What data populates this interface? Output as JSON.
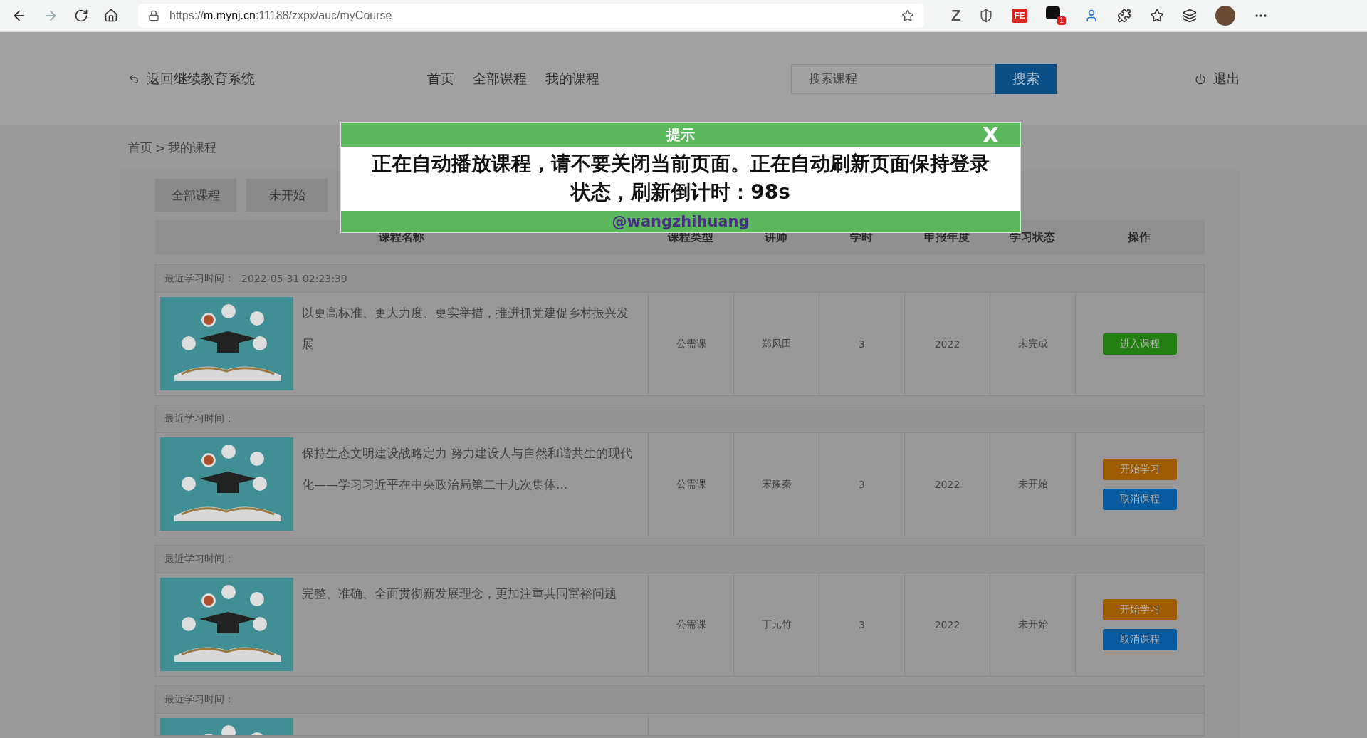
{
  "browser": {
    "url_scheme": "https://",
    "url_host": "m.mynj.cn",
    "url_rest": ":11188/zxpx/auc/myCourse",
    "toolbar_icons": [
      {
        "kind": "letter",
        "text": "Z"
      },
      {
        "kind": "shield"
      },
      {
        "kind": "tag",
        "text": "FE"
      },
      {
        "kind": "badge",
        "text": "1"
      },
      {
        "kind": "person"
      },
      {
        "kind": "puzzle"
      },
      {
        "kind": "favorites"
      },
      {
        "kind": "collections"
      },
      {
        "kind": "avatar"
      },
      {
        "kind": "more"
      }
    ]
  },
  "header": {
    "back_link": "返回继续教育系统",
    "nav": [
      "首页",
      "全部课程",
      "我的课程"
    ],
    "search": {
      "placeholder": "搜索课程",
      "button": "搜索"
    },
    "logout": "退出"
  },
  "breadcrumb": {
    "items": [
      "首页",
      "我的课程"
    ],
    "separator": ">"
  },
  "tabs": [
    "全部课程",
    "未开始"
  ],
  "table": {
    "columns": [
      "课程名称",
      "课程类型",
      "讲师",
      "学时",
      "申报年度",
      "学习状态",
      "操作"
    ],
    "rows": [
      {
        "last_study_label": "最近学习时间：",
        "last_study_time": "2022-05-31 02:23:39",
        "title": "以更高标准、更大力度、更实举措，推进抓党建促乡村振兴发展",
        "type": "公需课",
        "teacher": "郑风田",
        "hours": "3",
        "year": "2022",
        "status": "未完成",
        "actions": [
          {
            "label": "进入课程",
            "kind": "enter"
          }
        ]
      },
      {
        "last_study_label": "最近学习时间：",
        "title": "保持生态文明建设战略定力 努力建设人与自然和谐共生的现代化——学习习近平在中央政治局第二十九次集体...",
        "type": "公需课",
        "teacher": "宋豫秦",
        "hours": "3",
        "year": "2022",
        "status": "未开始",
        "actions": [
          {
            "label": "开始学习",
            "kind": "start"
          },
          {
            "label": "取消课程",
            "kind": "cancel"
          }
        ]
      },
      {
        "last_study_label": "最近学习时间：",
        "title": "完整、准确、全面贯彻新发展理念，更加注重共同富裕问题",
        "type": "公需课",
        "teacher": "丁元竹",
        "hours": "3",
        "year": "2022",
        "status": "未开始",
        "actions": [
          {
            "label": "开始学习",
            "kind": "start"
          },
          {
            "label": "取消课程",
            "kind": "cancel"
          }
        ]
      },
      {
        "last_study_label": "最近学习时间："
      }
    ]
  },
  "modal": {
    "title": "提示",
    "close": "X",
    "message": "正在自动播放课程，请不要关闭当前页面。正在自动刷新页面保持登录状态，刷新倒计时：98s",
    "footer": "@wangzhihuang"
  }
}
